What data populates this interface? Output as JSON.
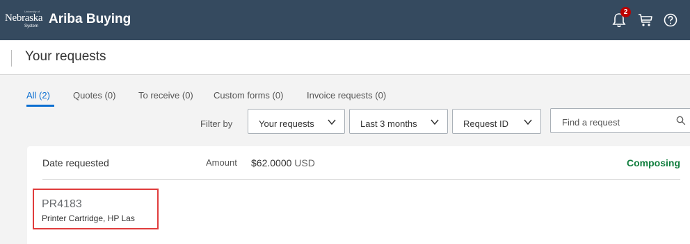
{
  "header": {
    "logo_text": "Nebraska",
    "logo_small_top": "University of",
    "logo_small_bottom": "System",
    "app_title": "Ariba Buying",
    "notifications_count": "2",
    "icons": [
      "bell-icon",
      "cart-icon",
      "help-icon"
    ],
    "background_color": "#354a5f"
  },
  "subheader": {
    "page_title": "Your requests"
  },
  "tabs": [
    {
      "label": "All (2)",
      "active": true
    },
    {
      "label": "Quotes (0)",
      "active": false
    },
    {
      "label": "To receive (0)",
      "active": false
    },
    {
      "label": "Custom forms (0)",
      "active": false
    },
    {
      "label": "Invoice requests (0)",
      "active": false
    }
  ],
  "filters": {
    "label": "Filter by",
    "dropdowns": [
      {
        "label": "Your requests"
      },
      {
        "label": "Last 3 months"
      },
      {
        "label": "Request ID"
      }
    ],
    "search_placeholder": "Find a request"
  },
  "request_card": {
    "date_label": "Date requested",
    "amount_label": "Amount",
    "amount_value": "$62.0000",
    "amount_currency": "USD",
    "status": "Composing",
    "status_color": "#107e3e",
    "request_id": "PR4183",
    "description": "Printer Cartridge, HP Las"
  },
  "colors": {
    "accent": "#0a6ed1",
    "highlight_border": "#e03c3c"
  }
}
